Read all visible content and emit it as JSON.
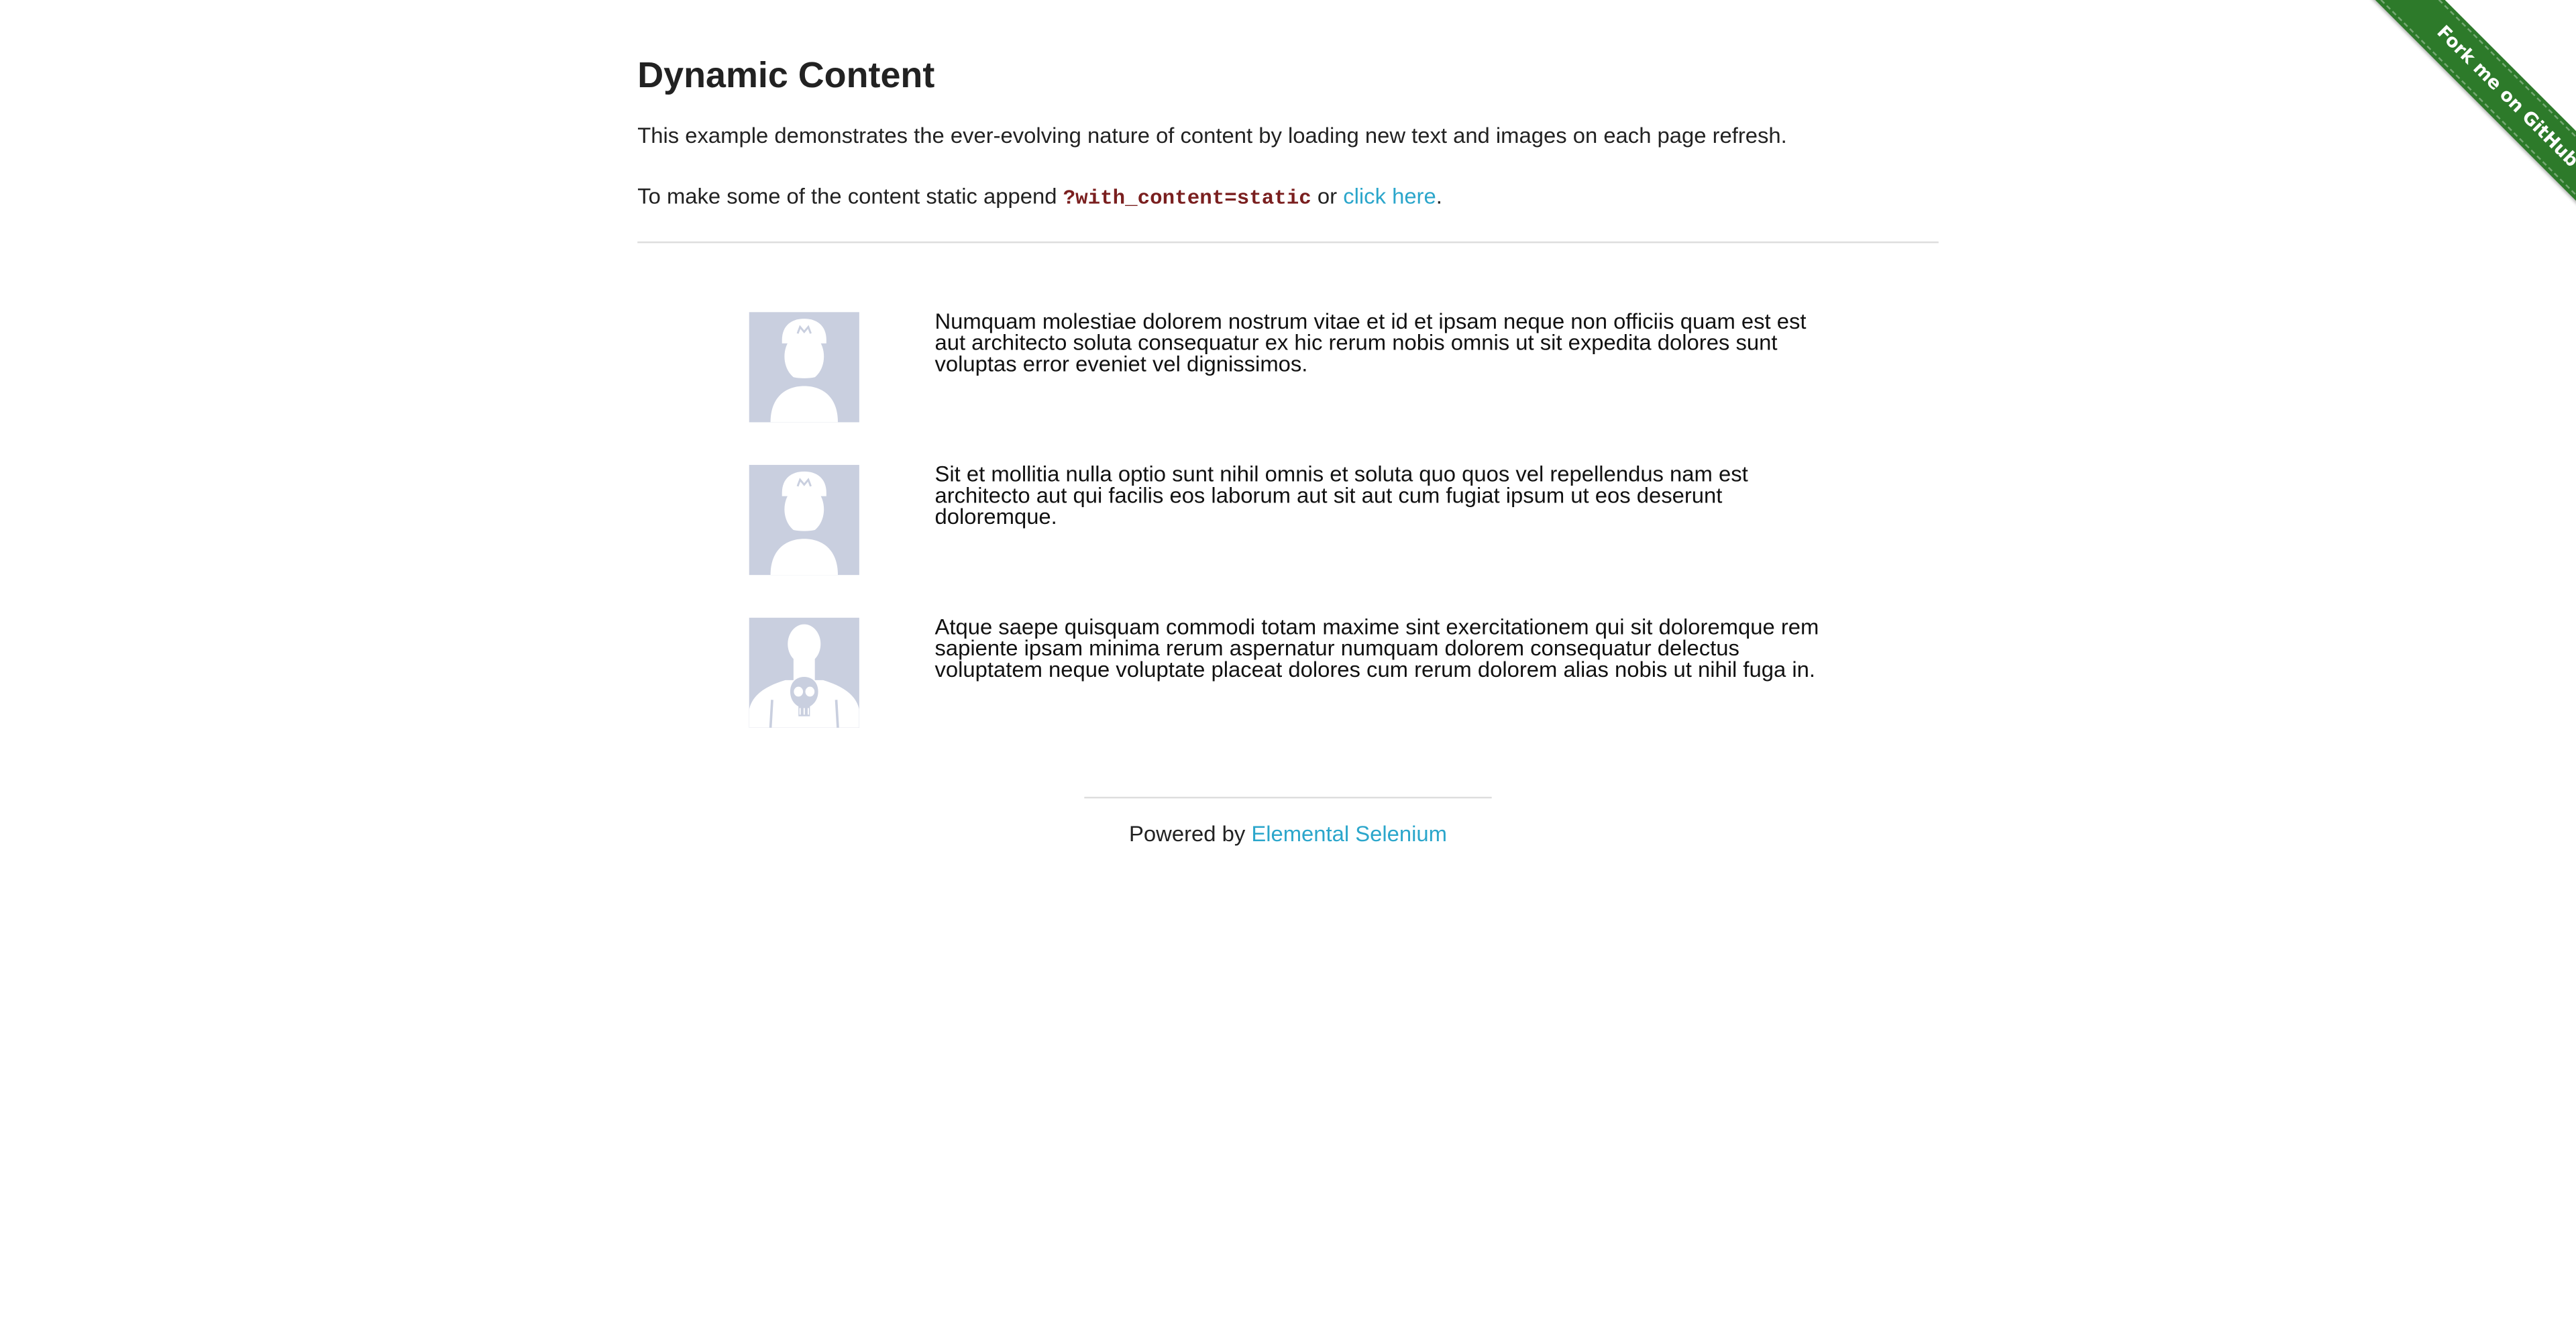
{
  "ribbon": {
    "label": "Fork me on GitHub",
    "color": "#2d7a2a"
  },
  "header": {
    "title": "Dynamic Content"
  },
  "intro": {
    "description": "This example demonstrates the ever-evolving nature of content by loading new text and images on each page refresh.",
    "static_prefix": "To make some of the content static append ",
    "static_code": "?with_content=static",
    "static_or": " or ",
    "static_link": "click here",
    "static_suffix": "."
  },
  "rows": [
    {
      "avatar_icon": "mario-avatar-icon",
      "text": "Numquam molestiae dolorem nostrum vitae et id et ipsam neque non officiis quam est est aut architecto soluta consequatur ex hic rerum nobis omnis ut sit expedita dolores sunt voluptas error eveniet vel dignissimos."
    },
    {
      "avatar_icon": "mario-avatar-icon",
      "text": "Sit et mollitia nulla optio sunt nihil omnis et soluta quo quos vel repellendus nam est architecto aut qui facilis eos laborum aut sit aut cum fugiat ipsum ut eos deserunt doloremque."
    },
    {
      "avatar_icon": "punisher-avatar-icon",
      "text": "Atque saepe quisquam commodi totam maxime sint exercitationem qui sit doloremque rem sapiente ipsam minima rerum aspernatur numquam dolorem consequatur delectus voluptatem neque voluptate placeat dolores cum rerum dolorem alias nobis ut nihil fuga in."
    }
  ],
  "footer": {
    "prefix": "Powered by ",
    "link": "Elemental Selenium"
  },
  "colors": {
    "link": "#2ba6cb",
    "code": "#7a1f1f",
    "avatar_bg": "#c9cfdf"
  }
}
